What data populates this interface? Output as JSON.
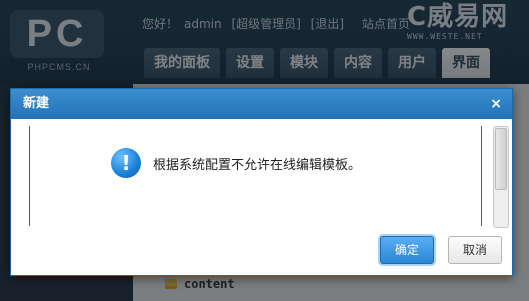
{
  "header": {
    "logo_text": "PC",
    "logo_sub": "PHPCMS.CN",
    "greeting": "您好！",
    "username": "admin",
    "role": "[超级管理员]",
    "logout": "[退出]",
    "site_home": "站点首页",
    "brand_text": "C威易网",
    "brand_url": "WWW.WESTE.NET"
  },
  "tabs": [
    {
      "label": "我的面板"
    },
    {
      "label": "设置"
    },
    {
      "label": "模块"
    },
    {
      "label": "内容"
    },
    {
      "label": "用户"
    },
    {
      "label": "界面"
    }
  ],
  "main": {
    "folder_label": "content"
  },
  "dialog": {
    "title": "新建",
    "close_glyph": "×",
    "info_glyph": "!",
    "message": "根据系统配置不允许在线编辑模板。",
    "ok_label": "确定",
    "cancel_label": "取消"
  }
}
